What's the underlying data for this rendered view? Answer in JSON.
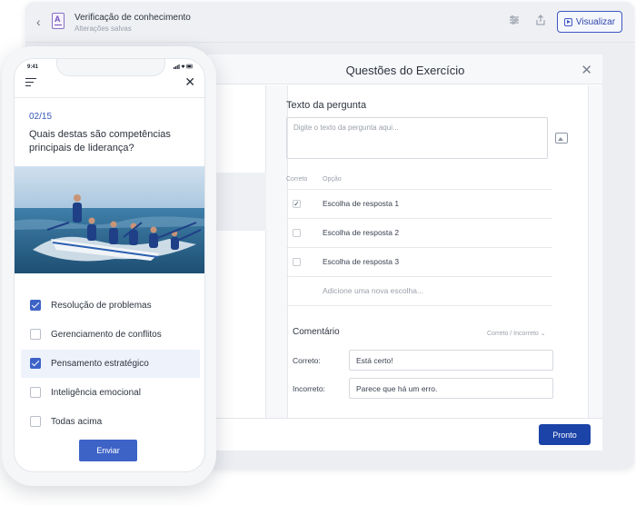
{
  "editor": {
    "app_title": "Verificação de conhecimento",
    "app_subtitle": "Alterações salvas",
    "preview_label": "Visualizar",
    "icons": [
      "back-icon",
      "document-icon",
      "sliders-icon",
      "share-icon",
      "play-icon"
    ]
  },
  "modal": {
    "title": "Questões do Exercício",
    "question_label": "Texto da pergunta",
    "question_placeholder": "Digite o texto da pergunta aqui...",
    "col_correct": "Correto",
    "col_option": "Opção",
    "options": [
      {
        "label": "Escolha de resposta 1",
        "correct": true
      },
      {
        "label": "Escolha de resposta 2",
        "correct": false
      },
      {
        "label": "Escolha de resposta 3",
        "correct": false
      }
    ],
    "add_option": "Adicione uma nova escolha...",
    "comment_title": "Comentário",
    "comment_toggle": "Correto / Incorreto",
    "correct_label": "Correto:",
    "correct_value": "Está certo!",
    "incorrect_label": "Incorreto:",
    "incorrect_value": "Parece que há um erro.",
    "done_label": "Pronto"
  },
  "phone": {
    "time": "9:41",
    "counter": "02/15",
    "question": "Quais destas são competências principais de liderança?",
    "answers": [
      {
        "label": "Resolução de problemas",
        "checked": true,
        "highlighted": false
      },
      {
        "label": "Gerenciamento de conflitos",
        "checked": false,
        "highlighted": false
      },
      {
        "label": "Pensamento estratégico",
        "checked": true,
        "highlighted": true
      },
      {
        "label": "Inteligência emocional",
        "checked": false,
        "highlighted": false
      },
      {
        "label": "Todas acima",
        "checked": false,
        "highlighted": false
      }
    ],
    "submit_label": "Enviar"
  },
  "colors": {
    "primary": "#3d63c7",
    "dark_primary": "#1b43a8",
    "highlight": "#edf2fb"
  }
}
